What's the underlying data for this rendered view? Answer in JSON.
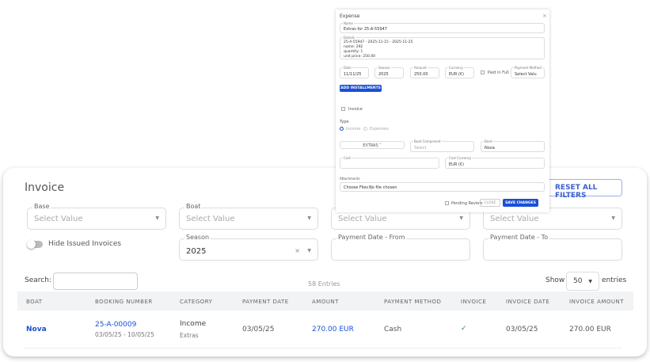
{
  "page": {
    "title": "Invoice",
    "reset_label": "RESET ALL FILTERS"
  },
  "filters": {
    "base": {
      "label": "Base",
      "value": "Select Value"
    },
    "boat": {
      "label": "Boat",
      "value": "Select Value"
    },
    "filter3": {
      "value": "Select Value"
    },
    "filter4": {
      "value": "Select Value"
    },
    "hide_issued": {
      "label": "Hide Issued Invoices",
      "on": false
    },
    "season": {
      "label": "Season",
      "value": "2025",
      "clear": "×"
    },
    "pay_from": {
      "label": "Payment Date - From",
      "value": ""
    },
    "pay_to": {
      "label": "Payment Date - To",
      "value": ""
    }
  },
  "table_controls": {
    "search_label": "Search:",
    "entries": "58 Entries",
    "show_label": "Show",
    "page_size": "50",
    "entries_label": "entries"
  },
  "table": {
    "columns": [
      "BOAT",
      "BOOKING NUMBER",
      "CATEGORY",
      "PAYMENT DATE",
      "AMOUNT",
      "PAYMENT METHOD",
      "INVOICE",
      "INVOICE DATE",
      "INVOICE AMOUNT"
    ],
    "rows": [
      {
        "boat": "Nova",
        "booking": "25-A-00009",
        "booking_dates": "03/05/25 - 10/05/25",
        "category": "Income",
        "subcategory": "Extras",
        "payment_date": "03/05/25",
        "amount": "270.00 EUR",
        "method": "Cash",
        "invoice": "✓",
        "invoice_date": "03/05/25",
        "invoice_amount": "270.00 EUR"
      }
    ]
  },
  "modal": {
    "title": "Expense",
    "close": "×",
    "name_label": "Name",
    "name": "Extras for 25-A-55947",
    "details_label": "Details",
    "details": "25-A-55947 - 2025-11-15 - 2025-11-25\nname: 292\nquantity: 1\nunit price: 250.00",
    "date_label": "Date",
    "date": "11/11/25",
    "season_label": "Season",
    "season": "2025",
    "amount_label": "Amount",
    "amount": "250.00",
    "currency_label": "Currency",
    "currency": "EUR (€)",
    "paid_label": "Paid in Full",
    "method_label": "Payment Method",
    "method": "Select Valu",
    "add_installments": "ADD INSTALLMENTS",
    "invoice_label": "Invoice",
    "type_label": "Type",
    "income": "Income",
    "expenses": "Expenses",
    "extras": "EXTRAS ˅",
    "component_label": "Boat Component",
    "component": "Select",
    "boat_label": "Boat",
    "boat": "Nova",
    "cost_label": "Cost",
    "cost_currency_label": "Cost Currency",
    "cost_currency": "EUR (€)",
    "attachments_label": "Attachments",
    "choose_files": "Choose Files",
    "no_file": "No file chosen",
    "pending_label": "Pending Review",
    "close_btn": "CLOSE",
    "save_btn": "SAVE CHANGES"
  },
  "colors": {
    "accent": "#1a4fd6",
    "link": "#1a4fd6",
    "check": "#2a9d2a"
  }
}
